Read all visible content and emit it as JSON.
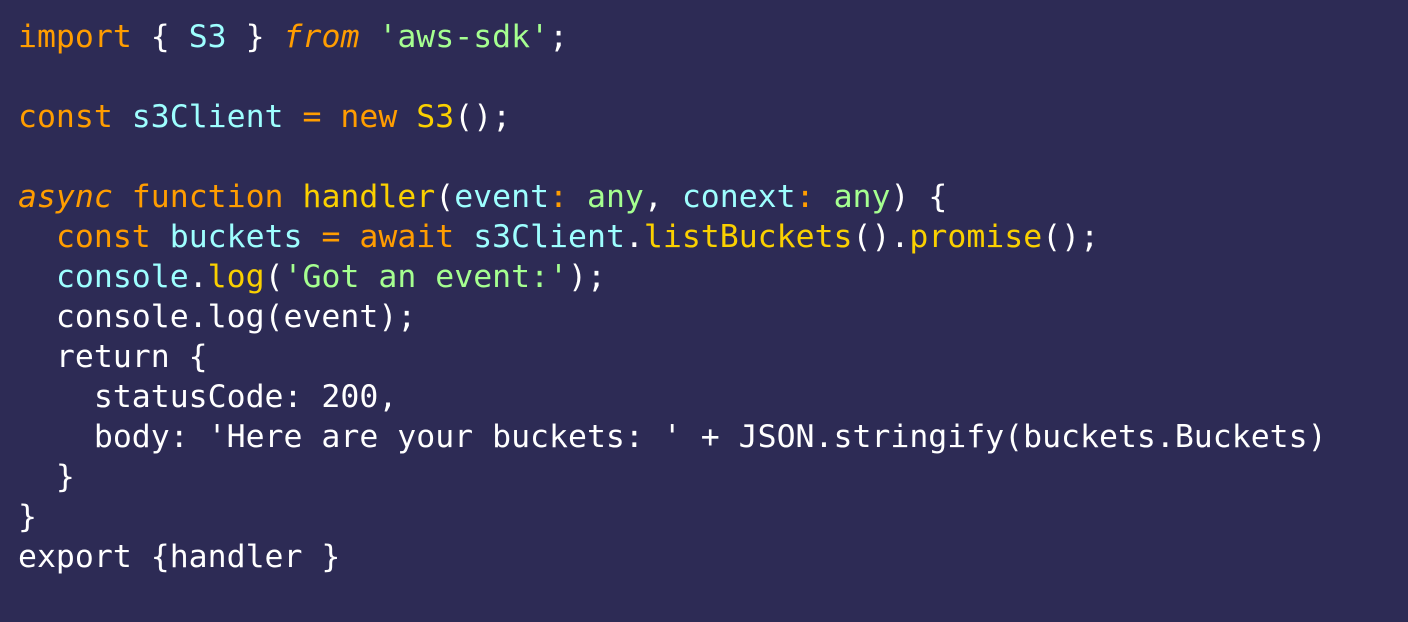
{
  "colors": {
    "background": "#2d2b55",
    "plain": "#ffffff",
    "keyword": "#ff9d00",
    "identifier": "#9effff",
    "class_function": "#fad000",
    "string_type": "#a5ff90"
  },
  "code": {
    "lines": [
      [
        {
          "text": "import",
          "kind": "keyword"
        },
        {
          "text": " { ",
          "kind": "punct"
        },
        {
          "text": "S3",
          "kind": "ident"
        },
        {
          "text": " } ",
          "kind": "punct"
        },
        {
          "text": "from",
          "kind": "italic"
        },
        {
          "text": " ",
          "kind": "plain"
        },
        {
          "text": "'aws-sdk'",
          "kind": "string"
        },
        {
          "text": ";",
          "kind": "punct"
        }
      ],
      [],
      [
        {
          "text": "const",
          "kind": "keyword"
        },
        {
          "text": " ",
          "kind": "plain"
        },
        {
          "text": "s3Client",
          "kind": "ident"
        },
        {
          "text": " ",
          "kind": "plain"
        },
        {
          "text": "=",
          "kind": "op"
        },
        {
          "text": " ",
          "kind": "plain"
        },
        {
          "text": "new",
          "kind": "keyword"
        },
        {
          "text": " ",
          "kind": "plain"
        },
        {
          "text": "S3",
          "kind": "class"
        },
        {
          "text": "();",
          "kind": "punct"
        }
      ],
      [],
      [
        {
          "text": "async",
          "kind": "italic"
        },
        {
          "text": " ",
          "kind": "plain"
        },
        {
          "text": "function",
          "kind": "keyword"
        },
        {
          "text": " ",
          "kind": "plain"
        },
        {
          "text": "handler",
          "kind": "func"
        },
        {
          "text": "(",
          "kind": "punct"
        },
        {
          "text": "event",
          "kind": "ident"
        },
        {
          "text": ":",
          "kind": "colon"
        },
        {
          "text": " ",
          "kind": "plain"
        },
        {
          "text": "any",
          "kind": "type"
        },
        {
          "text": ", ",
          "kind": "punct"
        },
        {
          "text": "conext",
          "kind": "ident"
        },
        {
          "text": ":",
          "kind": "colon"
        },
        {
          "text": " ",
          "kind": "plain"
        },
        {
          "text": "any",
          "kind": "type"
        },
        {
          "text": ") {",
          "kind": "punct"
        }
      ],
      [
        {
          "text": "  ",
          "kind": "plain"
        },
        {
          "text": "const",
          "kind": "keyword"
        },
        {
          "text": " ",
          "kind": "plain"
        },
        {
          "text": "buckets",
          "kind": "ident"
        },
        {
          "text": " ",
          "kind": "plain"
        },
        {
          "text": "=",
          "kind": "op"
        },
        {
          "text": " ",
          "kind": "plain"
        },
        {
          "text": "await",
          "kind": "keyword"
        },
        {
          "text": " ",
          "kind": "plain"
        },
        {
          "text": "s3Client",
          "kind": "ident"
        },
        {
          "text": ".",
          "kind": "punct"
        },
        {
          "text": "listBuckets",
          "kind": "func"
        },
        {
          "text": "().",
          "kind": "punct"
        },
        {
          "text": "promise",
          "kind": "func"
        },
        {
          "text": "();",
          "kind": "punct"
        }
      ],
      [
        {
          "text": "  ",
          "kind": "plain"
        },
        {
          "text": "console",
          "kind": "ident"
        },
        {
          "text": ".",
          "kind": "punct"
        },
        {
          "text": "log",
          "kind": "func"
        },
        {
          "text": "(",
          "kind": "punct"
        },
        {
          "text": "'Got an event:'",
          "kind": "string"
        },
        {
          "text": ");",
          "kind": "punct"
        }
      ],
      [
        {
          "text": "  console.log(event);",
          "kind": "plain"
        }
      ],
      [
        {
          "text": "  return {",
          "kind": "plain"
        }
      ],
      [
        {
          "text": "    statusCode: 200,",
          "kind": "plain"
        }
      ],
      [
        {
          "text": "    body: 'Here are your buckets: ' + JSON.stringify(buckets.Buckets)",
          "kind": "plain"
        }
      ],
      [
        {
          "text": "  }",
          "kind": "plain"
        }
      ],
      [
        {
          "text": "}",
          "kind": "plain"
        }
      ],
      [
        {
          "text": "export {handler }",
          "kind": "plain"
        }
      ]
    ]
  }
}
